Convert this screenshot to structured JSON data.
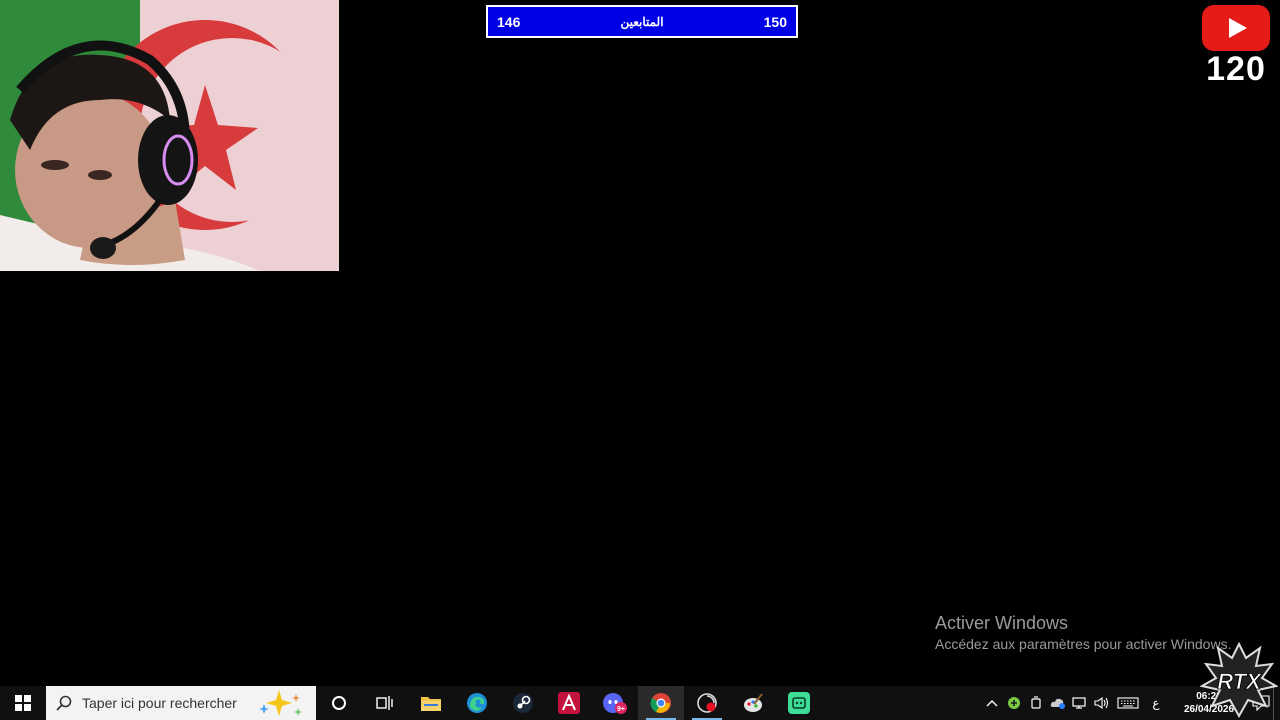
{
  "stream_overlay": {
    "follower_bar": {
      "left_count": "146",
      "label": "المتابعين",
      "right_count": "150"
    },
    "youtube_badge": {
      "icon": "youtube-icon",
      "count": "120"
    },
    "webcam": {
      "description_icon": "webcam-feed"
    },
    "rtx_logo_icon": "rtx-logo"
  },
  "watermark": {
    "title": "Activer Windows",
    "subtitle": "Accédez aux paramètres pour activer Windows."
  },
  "taskbar": {
    "search_placeholder": "Taper ici pour rechercher",
    "pinned": [
      {
        "name": "cortana",
        "icon": "cortana-icon"
      },
      {
        "name": "task-view",
        "icon": "task-view-icon"
      },
      {
        "name": "file-explorer",
        "icon": "folder-icon"
      },
      {
        "name": "edge",
        "icon": "edge-icon"
      },
      {
        "name": "steam",
        "icon": "steam-icon"
      },
      {
        "name": "app-red",
        "icon": "app-a-icon"
      },
      {
        "name": "discord",
        "icon": "discord-icon",
        "badge": "9+"
      },
      {
        "name": "chrome",
        "icon": "chrome-icon"
      },
      {
        "name": "obs",
        "icon": "record-icon"
      },
      {
        "name": "paint",
        "icon": "paint-icon"
      },
      {
        "name": "app-green",
        "icon": "app-green-icon"
      }
    ],
    "tray": {
      "language": "ع",
      "time": "06:28",
      "date": "26/04/2026",
      "notification_count": "2"
    }
  },
  "colors": {
    "follower_bar_bg": "#0000e6",
    "youtube_red": "#e41b17",
    "taskbar_bg": "#101010",
    "search_bg": "#f3f3f3"
  }
}
